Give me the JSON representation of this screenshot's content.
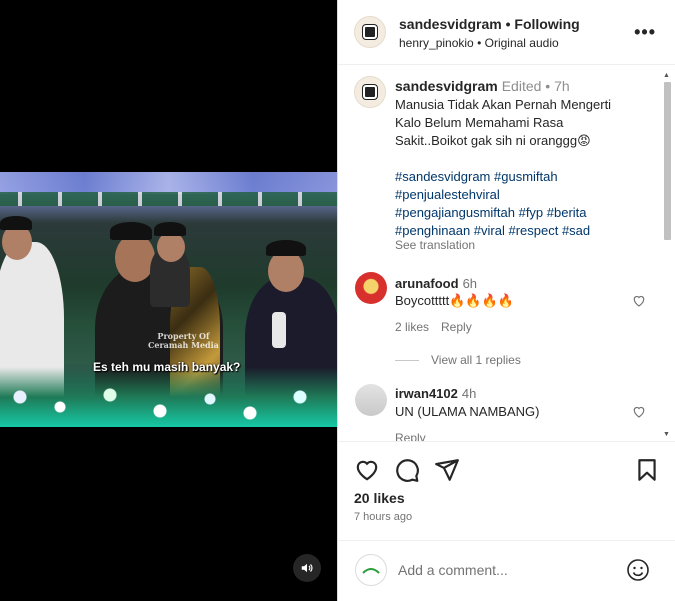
{
  "post": {
    "video_caption": "Es teh mu masih banyak?",
    "watermark_line1": "Property Of",
    "watermark_line2": "Ceramah Media"
  },
  "header": {
    "username": "sandesvidgram",
    "separator": "•",
    "follow_status": "Following",
    "audio_author": "henry_pinokio",
    "audio_label": "Original audio",
    "more_label": "•••"
  },
  "caption": {
    "username": "sandesvidgram",
    "meta": "Edited • 7h",
    "text": "Manusia Tidak Akan Pernah Mengerti Kalo Belum Memahami Rasa Sakit..Boikot gak sih ni oranggg😡",
    "hashtags_line1": "#sandesvidgram #gusmiftah",
    "hashtags_line2": "#penjualestehviral",
    "hashtags_line3": "#pengajiangusmiftah #fyp #berita",
    "hashtags_line4": "#penghinaan #viral #respect #sad",
    "see_translation": "See translation"
  },
  "comments": [
    {
      "username": "arunafood",
      "time": "6h",
      "text": "Boycottttt🔥🔥🔥🔥",
      "likes": "2 likes",
      "reply": "Reply",
      "view_replies": "View all 1 replies"
    },
    {
      "username": "irwan4102",
      "time": "4h",
      "text": "UN (ULAMA NAMBANG)",
      "reply": "Reply"
    }
  ],
  "actions": {
    "likes": "20 likes",
    "time_ago": "7 hours ago"
  },
  "add_comment": {
    "placeholder": "Add a comment..."
  },
  "icons": {
    "sound": "speaker-icon",
    "like": "heart-icon",
    "comment": "comment-bubble-icon",
    "share": "paper-plane-icon",
    "save": "bookmark-icon",
    "emoji": "smiley-icon"
  }
}
